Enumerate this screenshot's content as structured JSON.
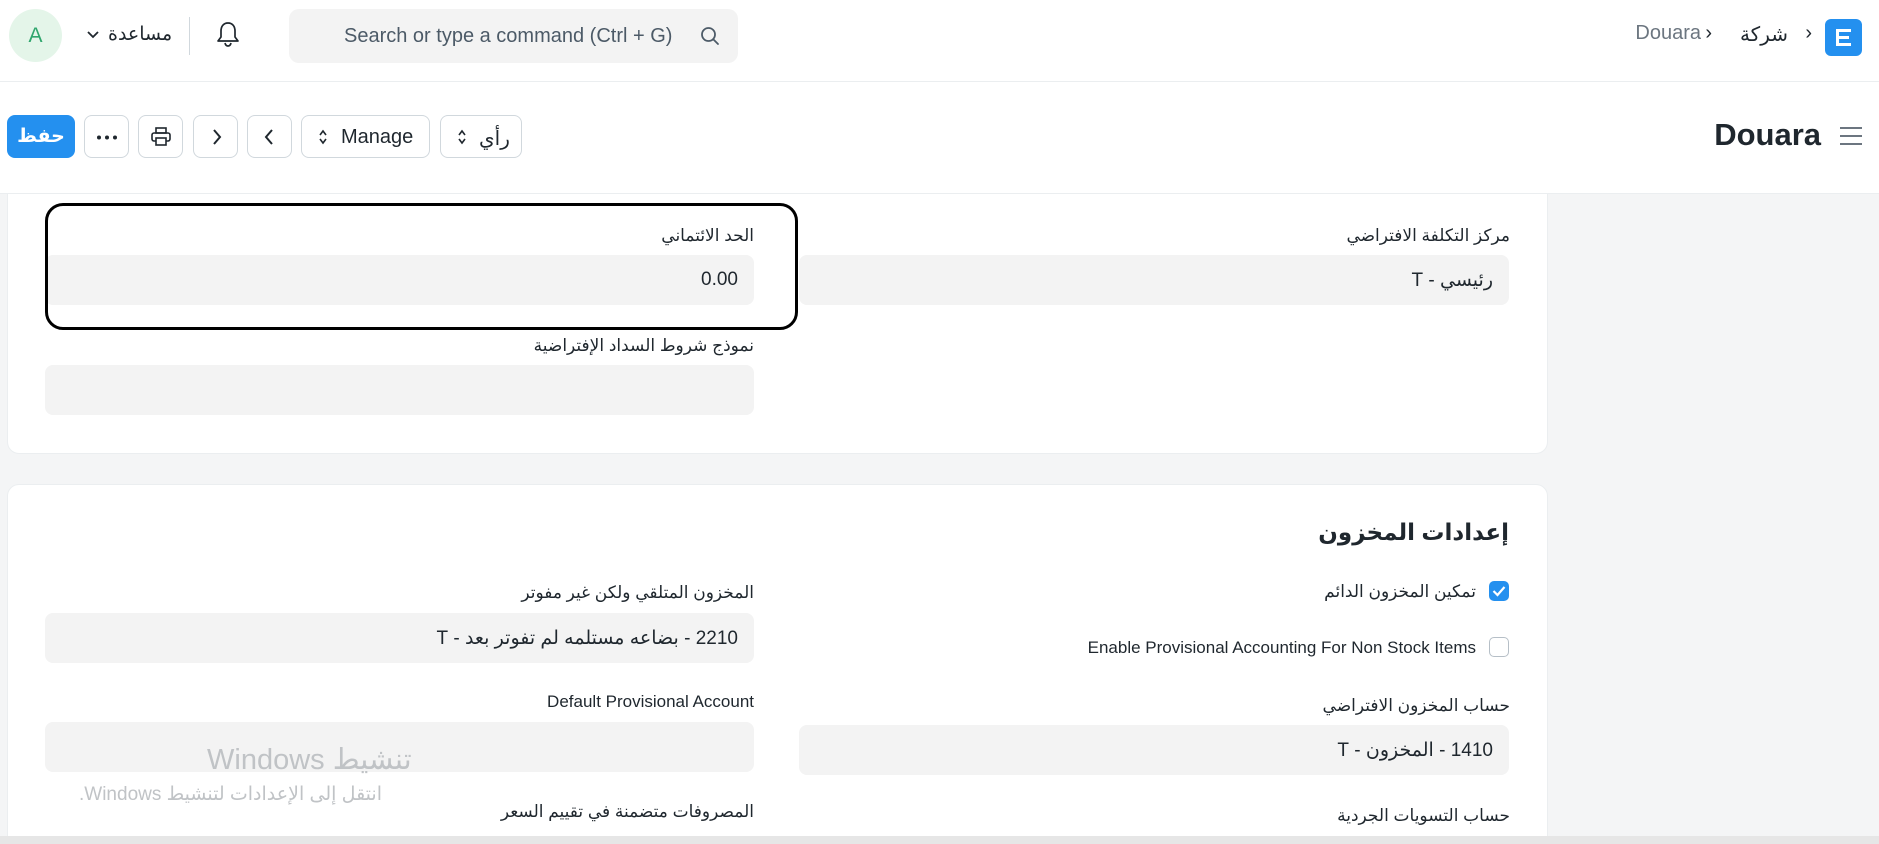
{
  "navbar": {
    "breadcrumbs": [
      "شركة",
      "Douara"
    ],
    "search_placeholder": "Search or type a command (Ctrl + G)",
    "help_label": "مساعدة",
    "avatar_initial": "A"
  },
  "page": {
    "title": "Douara",
    "buttons": {
      "save": "حفظ",
      "view": "رأي",
      "manage": "Manage"
    }
  },
  "card1": {
    "cost_center": {
      "label": "مركز التكلفة الافتراضي",
      "value": "رئيسي - T"
    },
    "credit_limit": {
      "label": "الحد الائتماني",
      "value": "0.00"
    },
    "payment_terms": {
      "label": "نموذج شروط السداد الإفتراضية",
      "value": ""
    }
  },
  "stock_settings": {
    "title": "إعدادات المخزون",
    "perpetual_inventory": {
      "label": "تمكين المخزون الدائم",
      "checked": true
    },
    "provisional_accounting": {
      "label": "Enable Provisional Accounting For Non Stock Items",
      "checked": false
    },
    "default_inventory_account": {
      "label": "حساب المخزون الافتراضي",
      "value": "1410 - المخزون - T"
    },
    "stock_adjustment_account": {
      "label": "حساب التسويات الجردية"
    },
    "stock_received_not_billed": {
      "label": "المخزون المتلقي ولكن غير مفوتر",
      "value": "2210 - بضاعه مستلمه لم تفوتر بعد - T"
    },
    "default_provisional_account": {
      "label": "Default Provisional Account",
      "value": ""
    },
    "expenses_in_valuation": {
      "label": "المصروفات متضمنة في تقييم السعر"
    }
  },
  "watermark": {
    "title": "تنشيط Windows",
    "subtitle": "انتقل إلى الإعدادات لتنشيط Windows."
  },
  "colors": {
    "primary": "#2490ef",
    "avatar_bg": "#e4f5e9",
    "avatar_fg": "#30a66d",
    "control_bg": "#f3f3f3"
  }
}
